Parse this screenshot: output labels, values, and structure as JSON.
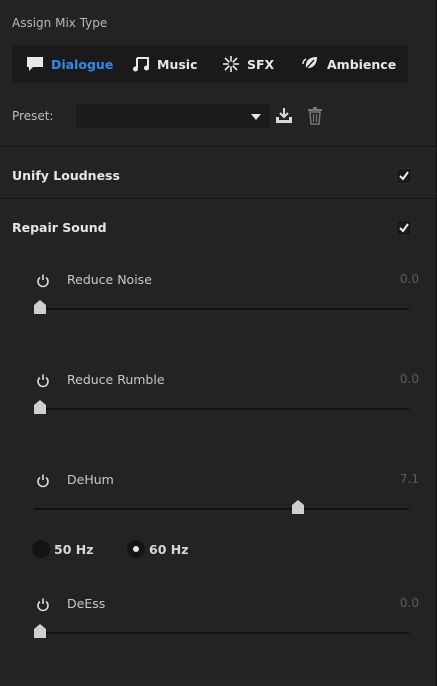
{
  "header": {
    "title": "Assign Mix Type"
  },
  "tabs": [
    {
      "label": "Dialogue",
      "icon": "speech-bubble-icon",
      "active": true
    },
    {
      "label": "Music",
      "icon": "music-note-icon",
      "active": false
    },
    {
      "label": "SFX",
      "icon": "burst-icon",
      "active": false
    },
    {
      "label": "Ambience",
      "icon": "leaf-icon",
      "active": false
    }
  ],
  "preset": {
    "label": "Preset:",
    "value": ""
  },
  "unify_loudness": {
    "label": "Unify Loudness",
    "checked": true
  },
  "repair_sound": {
    "label": "Repair Sound",
    "checked": true
  },
  "sliders": [
    {
      "label": "Reduce Noise",
      "value": "0.0",
      "level": 0.0
    },
    {
      "label": "Reduce Rumble",
      "value": "0.0",
      "level": 0.0
    },
    {
      "label": "DeHum",
      "value": "7.1",
      "level": 0.71
    },
    {
      "label": "DeEss",
      "value": "0.0",
      "level": 0.0
    }
  ],
  "dehum_frequency": {
    "options": [
      "50 Hz",
      "60 Hz"
    ],
    "selected": "60 Hz"
  },
  "colors": {
    "accent": "#2d8ceb",
    "background": "#232323"
  }
}
